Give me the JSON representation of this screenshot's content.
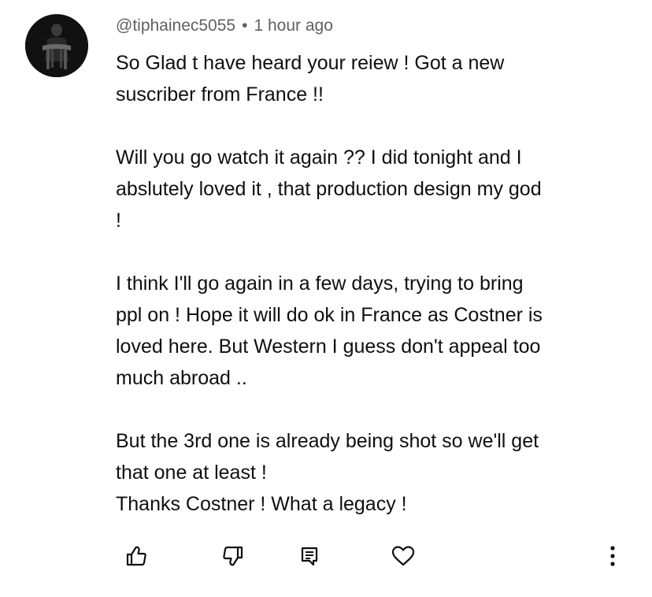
{
  "comment": {
    "author": "@tiphainec5055",
    "separator": "•",
    "time": "1 hour ago",
    "paragraphs": [
      [
        "So Glad t have heard your reiew ! Got a new",
        "suscriber from France !!"
      ],
      [
        "Will you go watch it again ?? I did tonight and I",
        "abslutely loved it , that production design my god",
        "!"
      ],
      [
        "I think I'll go again in a few days, trying to bring",
        "ppl on ! Hope it will do ok in France as Costner is",
        "loved here. But Western I guess don't appeal too",
        "much abroad .."
      ],
      [
        "But the 3rd one is already being shot so we'll get",
        "that one at least !",
        "Thanks Costner ! What a legacy !"
      ]
    ]
  },
  "actions": {
    "like_icon": "thumbs-up-icon",
    "dislike_icon": "thumbs-down-icon",
    "reply_icon": "reply-icon",
    "heart_icon": "heart-icon",
    "more_icon": "more-vertical-icon"
  }
}
